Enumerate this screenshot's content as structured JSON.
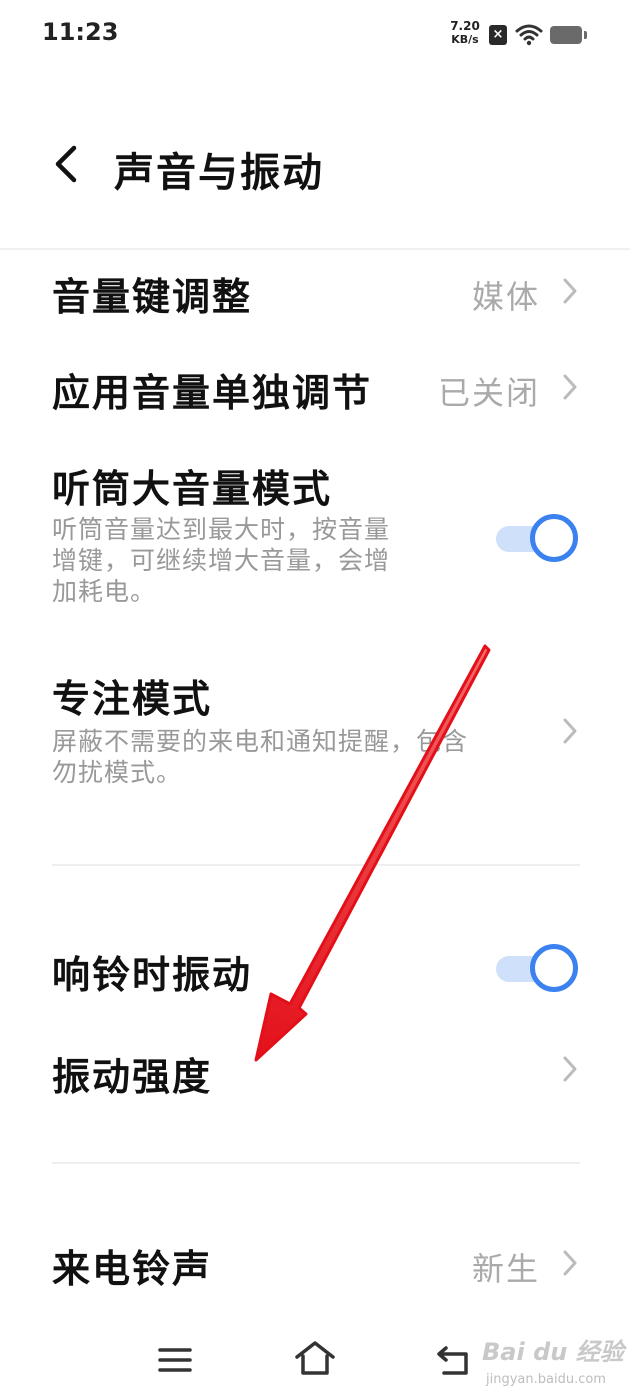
{
  "status_bar": {
    "time": "11:23",
    "net_speed_value": "7.20",
    "net_speed_unit": "KB/s",
    "sim_icon": "sim-none-icon",
    "wifi_icon": "wifi-icon",
    "battery_icon": "battery-icon"
  },
  "header": {
    "title": "声音与振动",
    "back_icon": "back-arrow-icon"
  },
  "settings": {
    "volume_keys": {
      "label": "音量键调整",
      "value": "媒体"
    },
    "app_volume": {
      "label": "应用音量单独调节",
      "value": "已关闭"
    },
    "earpiece_loud": {
      "label": "听筒大音量模式",
      "desc_line1": "听筒音量达到最大时，按音量",
      "desc_line2": "增键，可继续增大音量，会增",
      "desc_line3": "加耗电。",
      "enabled": true
    },
    "focus_mode": {
      "label": "专注模式",
      "desc_line1": "屏蔽不需要的来电和通知提醒，包含",
      "desc_line2": "勿扰模式。"
    },
    "vibrate_on_ring": {
      "label": "响铃时振动",
      "enabled": true
    },
    "vibration_strength": {
      "label": "振动强度"
    },
    "ringtone": {
      "label": "来电铃声",
      "value": "新生"
    }
  },
  "nav_bar": {
    "menu_icon": "menu-icon",
    "home_icon": "home-icon",
    "back_icon": "back-icon"
  },
  "watermark": {
    "logo_text": "Bai du 经验",
    "url": "jingyan.baidu.com"
  },
  "colors": {
    "accent": "#3b82f0",
    "toggle_track": "#cfe0fb",
    "secondary_text": "#aaaaaa",
    "annotation_arrow": "#e8141c"
  }
}
